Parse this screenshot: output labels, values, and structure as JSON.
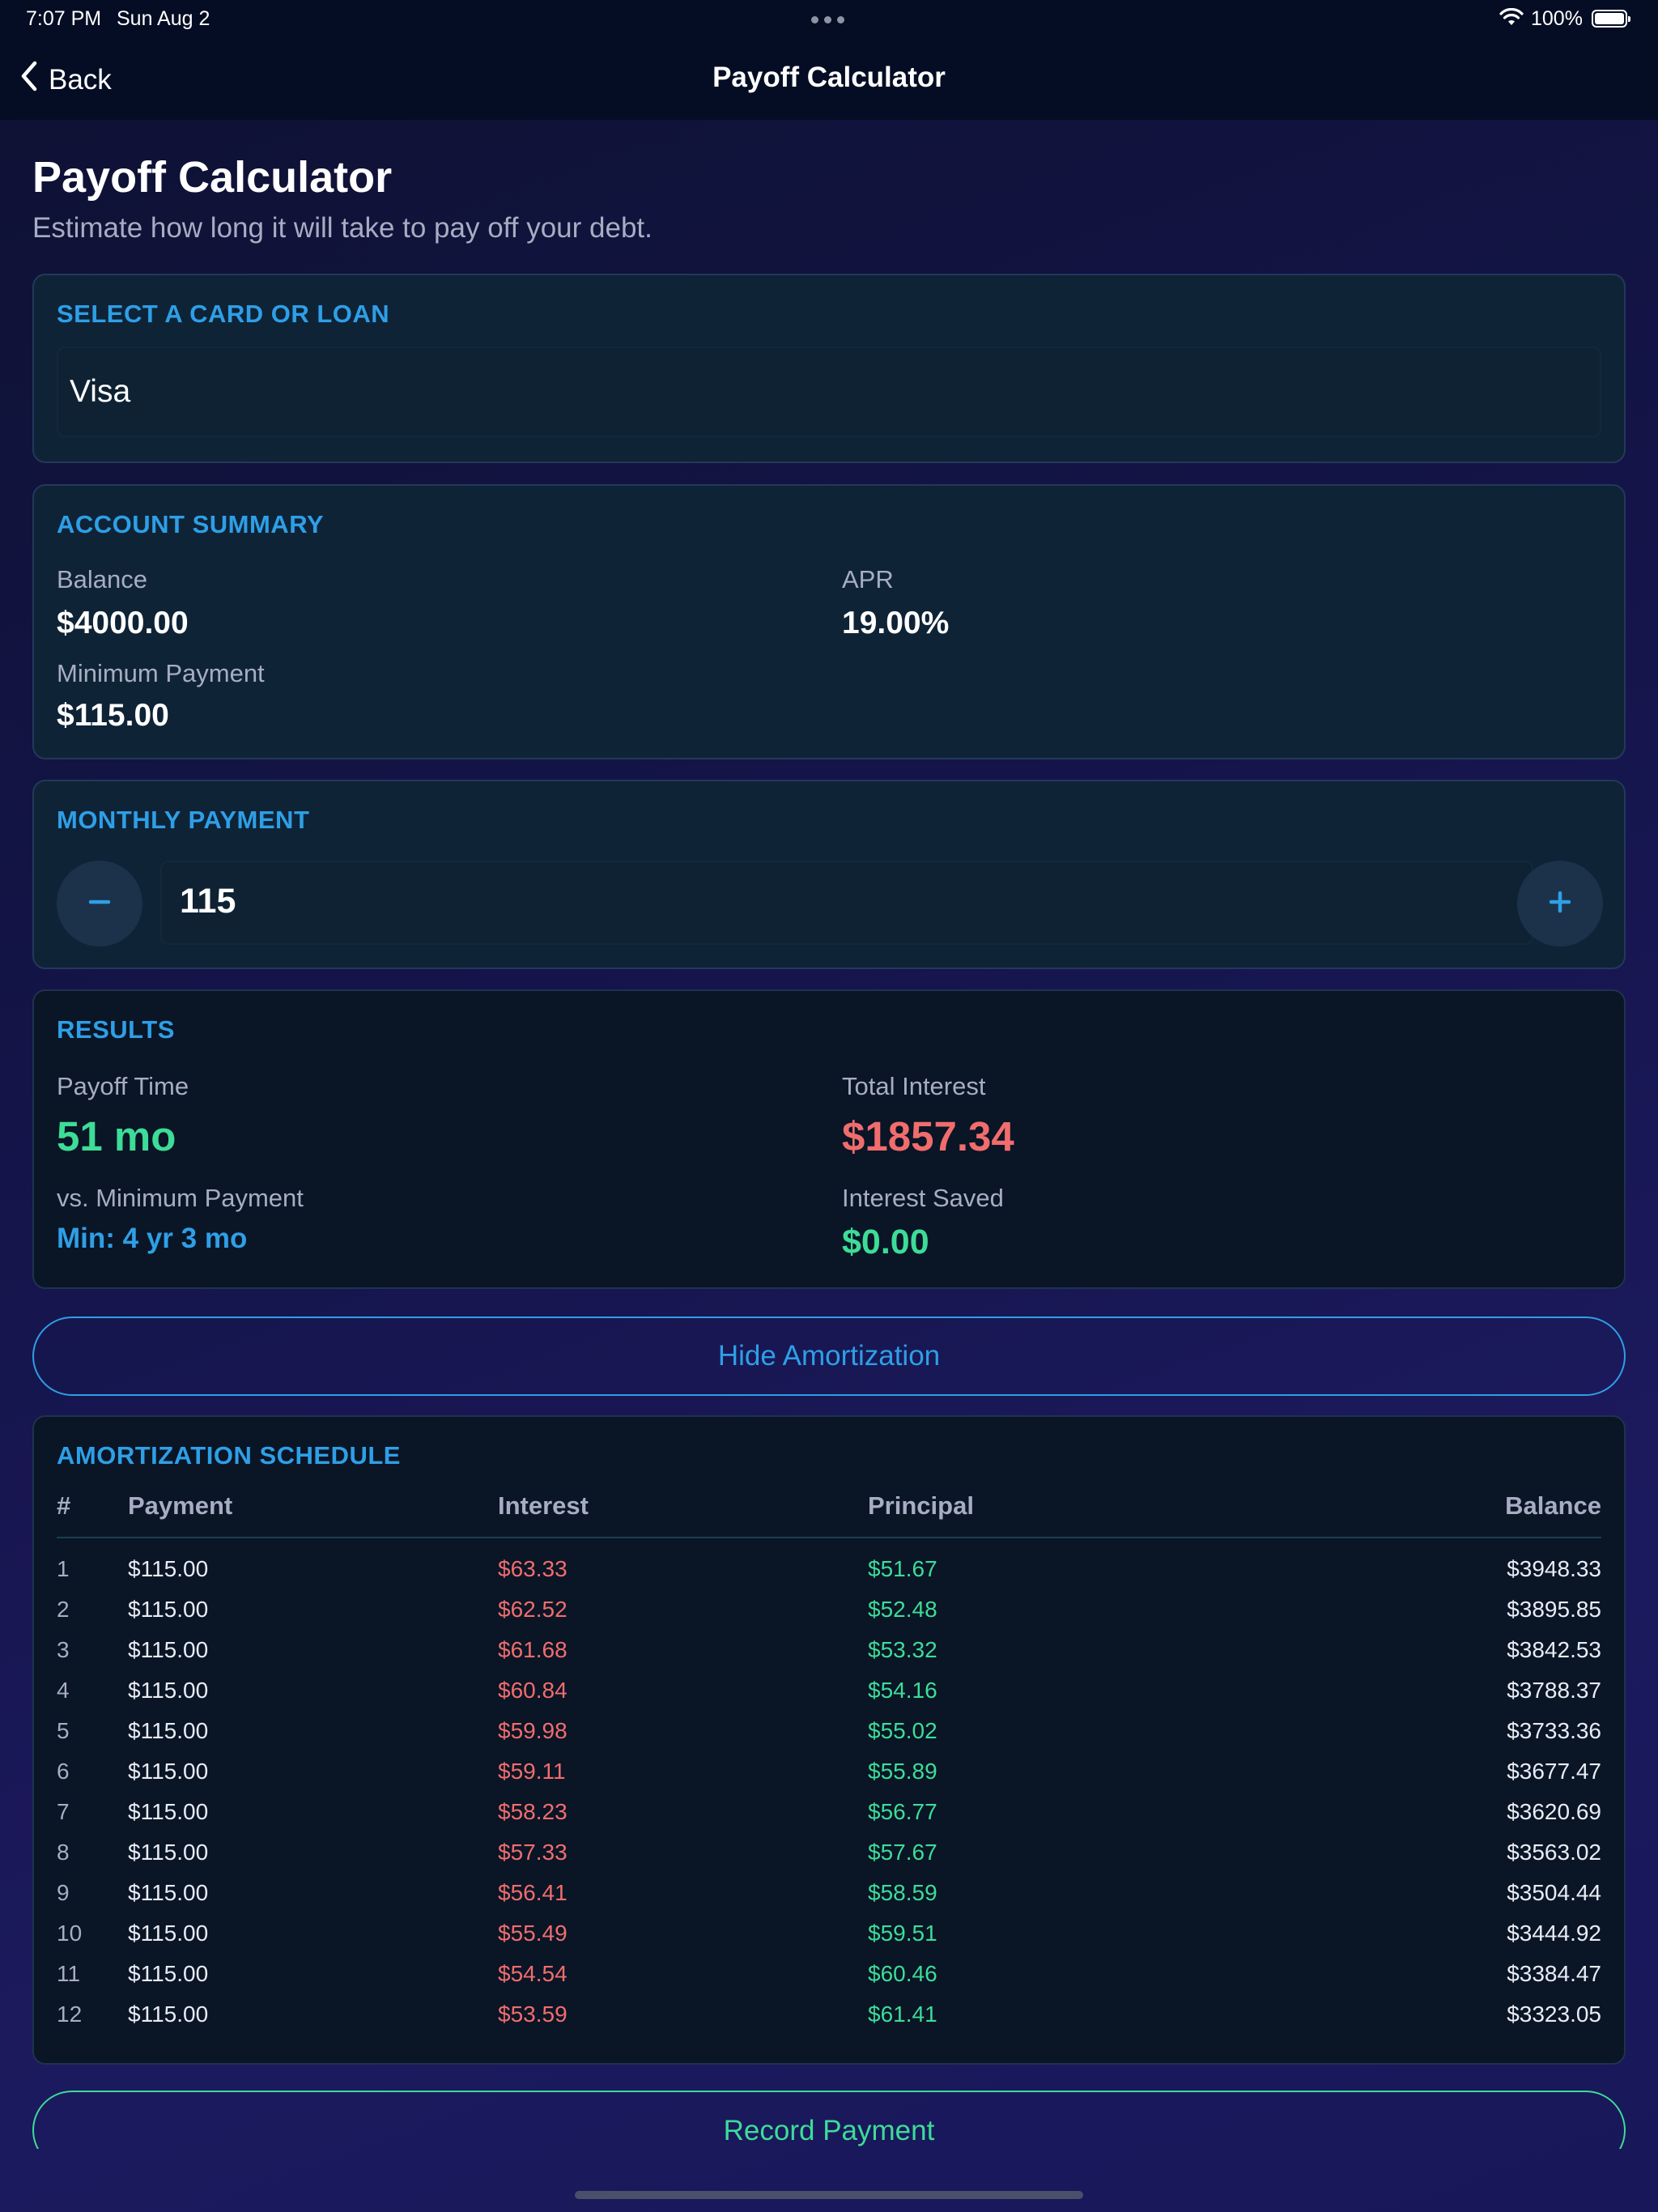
{
  "status_bar": {
    "time": "7:07 PM",
    "date": "Sun Aug 2",
    "battery": "100%"
  },
  "nav": {
    "back_label": "Back",
    "title": "Payoff Calculator"
  },
  "page": {
    "title": "Payoff Calculator",
    "subtitle": "Estimate how long it will take to pay off your debt."
  },
  "select_card": {
    "label": "SELECT A CARD OR LOAN",
    "value": "Visa"
  },
  "summary": {
    "label": "ACCOUNT SUMMARY",
    "balance_label": "Balance",
    "balance": "$4000.00",
    "apr_label": "APR",
    "apr": "19.00%",
    "min_label": "Minimum Payment",
    "min": "$115.00"
  },
  "monthly": {
    "label": "MONTHLY PAYMENT",
    "value": "115",
    "decrement_icon": "minus-icon",
    "increment_icon": "plus-icon"
  },
  "results": {
    "label": "RESULTS",
    "payoff_label": "Payoff Time",
    "payoff": "51 mo",
    "interest_label": "Total Interest",
    "interest": "$1857.34",
    "vs_label": "vs. Minimum Payment",
    "vs": "Min: 4 yr 3 mo",
    "saved_label": "Interest Saved",
    "saved": "$0.00"
  },
  "hide_amortization": "Hide Amortization",
  "amortization": {
    "label": "AMORTIZATION SCHEDULE",
    "headers": [
      "#",
      "Payment",
      "Interest",
      "Principal",
      "Balance"
    ],
    "rows": [
      [
        "1",
        "$115.00",
        "$63.33",
        "$51.67",
        "$3948.33"
      ],
      [
        "2",
        "$115.00",
        "$62.52",
        "$52.48",
        "$3895.85"
      ],
      [
        "3",
        "$115.00",
        "$61.68",
        "$53.32",
        "$3842.53"
      ],
      [
        "4",
        "$115.00",
        "$60.84",
        "$54.16",
        "$3788.37"
      ],
      [
        "5",
        "$115.00",
        "$59.98",
        "$55.02",
        "$3733.36"
      ],
      [
        "6",
        "$115.00",
        "$59.11",
        "$55.89",
        "$3677.47"
      ],
      [
        "7",
        "$115.00",
        "$58.23",
        "$56.77",
        "$3620.69"
      ],
      [
        "8",
        "$115.00",
        "$57.33",
        "$57.67",
        "$3563.02"
      ],
      [
        "9",
        "$115.00",
        "$56.41",
        "$58.59",
        "$3504.44"
      ],
      [
        "10",
        "$115.00",
        "$55.49",
        "$59.51",
        "$3444.92"
      ],
      [
        "11",
        "$115.00",
        "$54.54",
        "$60.46",
        "$3384.47"
      ],
      [
        "12",
        "$115.00",
        "$53.59",
        "$61.41",
        "$3323.05"
      ]
    ]
  },
  "record_payment": "Record Payment",
  "colors": {
    "accent": "#2e9fe6",
    "positive": "#3ddc97",
    "negative": "#f06d6d",
    "background": "#141449"
  }
}
